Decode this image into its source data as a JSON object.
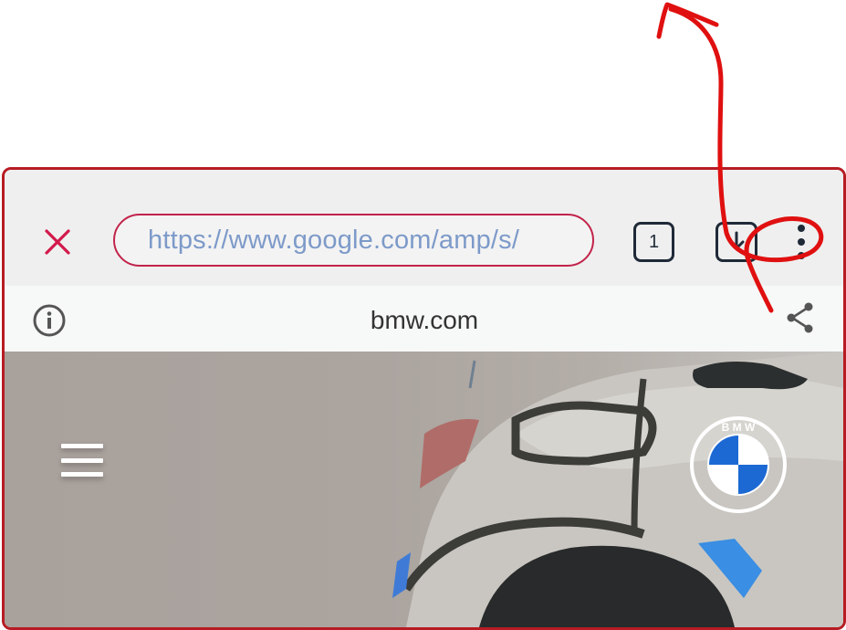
{
  "toolbar": {
    "url": "https://www.google.com/amp/s/",
    "tab_count": "1",
    "close_icon": "close-icon",
    "download_icon": "download-icon",
    "menu_icon": "more-vert-icon"
  },
  "infobar": {
    "domain": "bmw.com",
    "info_icon": "info-icon",
    "share_icon": "share-icon"
  },
  "page": {
    "menu_icon": "hamburger-menu-icon",
    "logo_letters": "B M W"
  },
  "colors": {
    "close": "#d2194b",
    "url_border": "#c2234a",
    "url_text": "#7d9ac9",
    "frame_border": "#b71c24",
    "annotation": "#e01010",
    "bmw_blue": "#1c69d4"
  }
}
